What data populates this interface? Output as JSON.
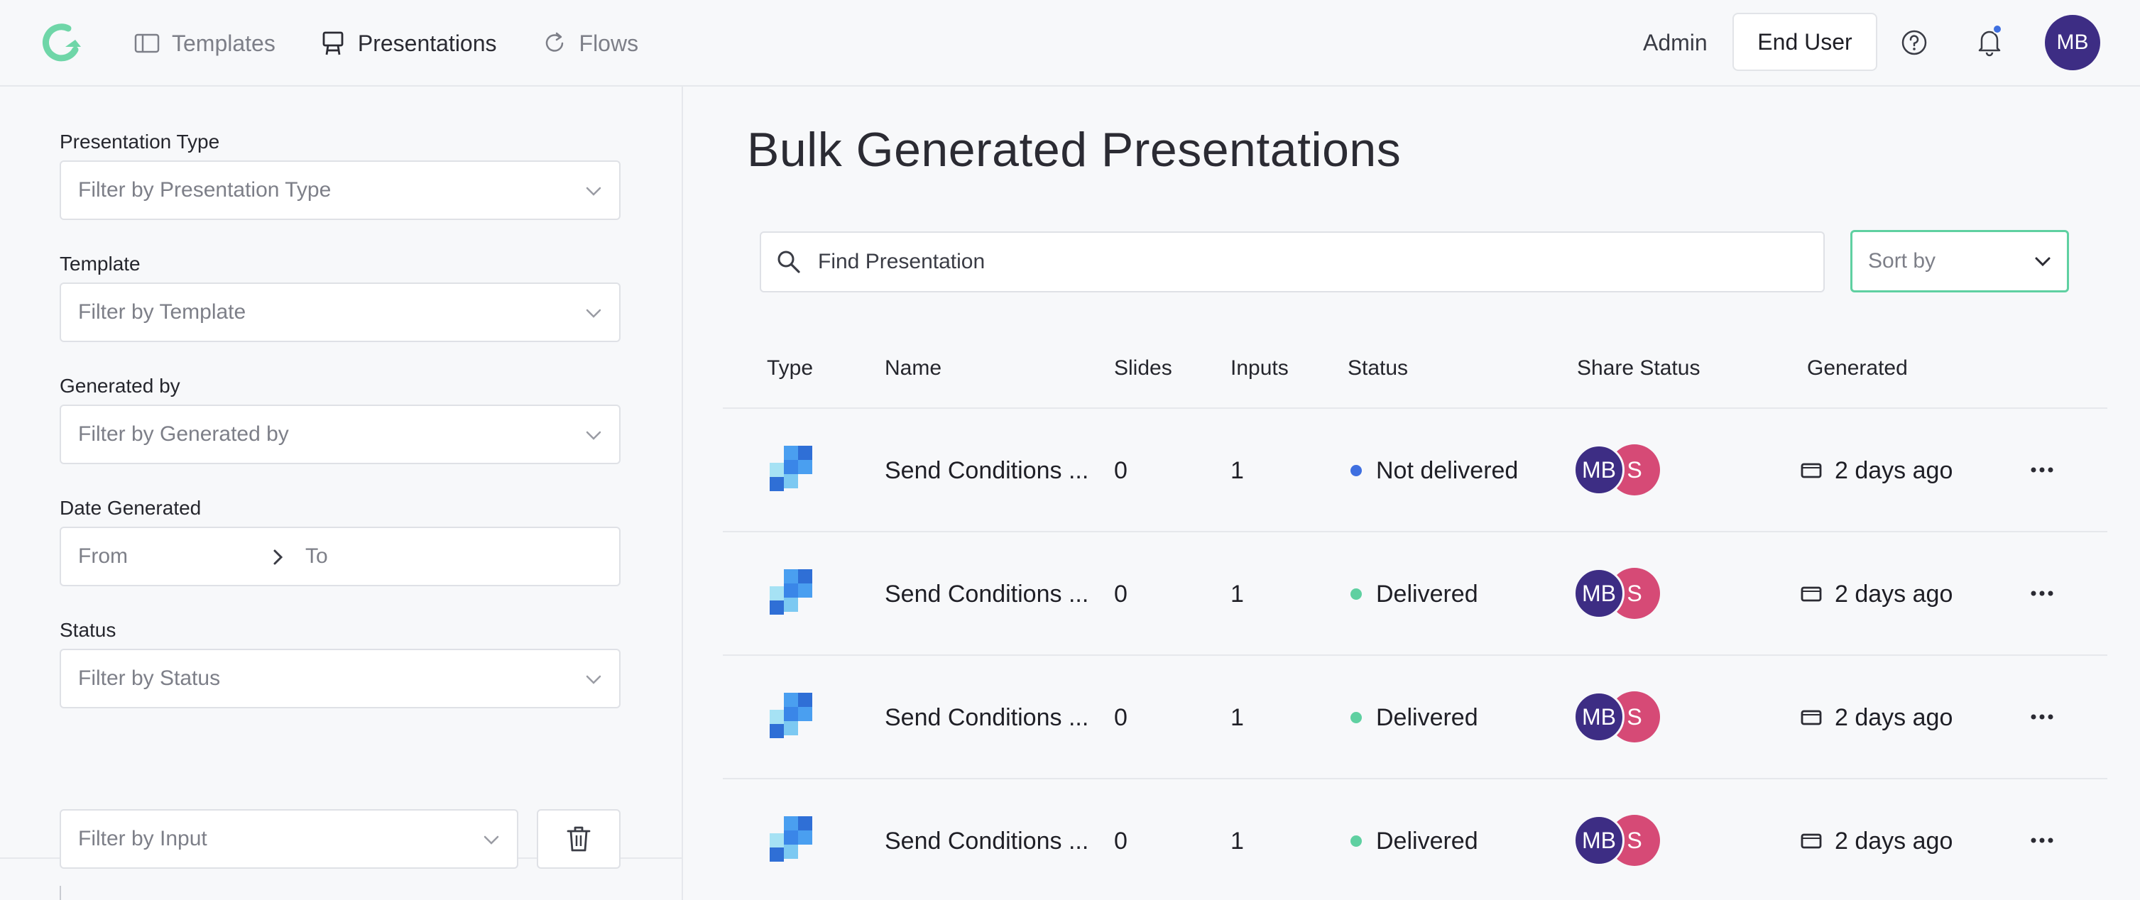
{
  "nav": {
    "items": [
      {
        "label": "Templates",
        "icon": "sidebar-panel-icon",
        "active": false
      },
      {
        "label": "Presentations",
        "icon": "easel-icon",
        "active": true
      },
      {
        "label": "Flows",
        "icon": "refresh-icon",
        "active": false
      }
    ]
  },
  "header": {
    "admin_label": "Admin",
    "end_user_label": "End User",
    "avatar_initials": "MB",
    "notification_dot_color": "#3f6fe0"
  },
  "filters": {
    "presentation_type": {
      "label": "Presentation Type",
      "placeholder": "Filter by Presentation Type"
    },
    "template": {
      "label": "Template",
      "placeholder": "Filter by Template"
    },
    "generated_by": {
      "label": "Generated by",
      "placeholder": "Filter by Generated by"
    },
    "date_generated": {
      "label": "Date Generated",
      "from": "From",
      "to": "To"
    },
    "status": {
      "label": "Status",
      "placeholder": "Filter by Status"
    },
    "input": {
      "placeholder": "Filter by Input"
    }
  },
  "main": {
    "title": "Bulk Generated Presentations",
    "search_placeholder": "Find Presentation",
    "sort_label": "Sort by",
    "sort_border_color": "#5fd0a1"
  },
  "table": {
    "columns": [
      "Type",
      "Name",
      "Slides",
      "Inputs",
      "Status",
      "Share Status",
      "Generated"
    ],
    "rows": [
      {
        "name": "Send Conditions ...",
        "slides": "0",
        "inputs": "1",
        "status": "Not delivered",
        "status_color": "#3f6fe0",
        "avatars": [
          "MB",
          "S"
        ],
        "generated": "2 days ago"
      },
      {
        "name": "Send Conditions ...",
        "slides": "0",
        "inputs": "1",
        "status": "Delivered",
        "status_color": "#5fd0a1",
        "avatars": [
          "MB",
          "S"
        ],
        "generated": "2 days ago"
      },
      {
        "name": "Send Conditions ...",
        "slides": "0",
        "inputs": "1",
        "status": "Delivered",
        "status_color": "#5fd0a1",
        "avatars": [
          "MB",
          "S"
        ],
        "generated": "2 days ago"
      },
      {
        "name": "Send Conditions ...",
        "slides": "0",
        "inputs": "1",
        "status": "Delivered",
        "status_color": "#5fd0a1",
        "avatars": [
          "MB",
          "S"
        ],
        "generated": "2 days ago"
      }
    ]
  },
  "colors": {
    "accent": "#5fd0a1",
    "avatar_primary": "#3d2d84",
    "avatar_secondary": "#d64a76"
  }
}
